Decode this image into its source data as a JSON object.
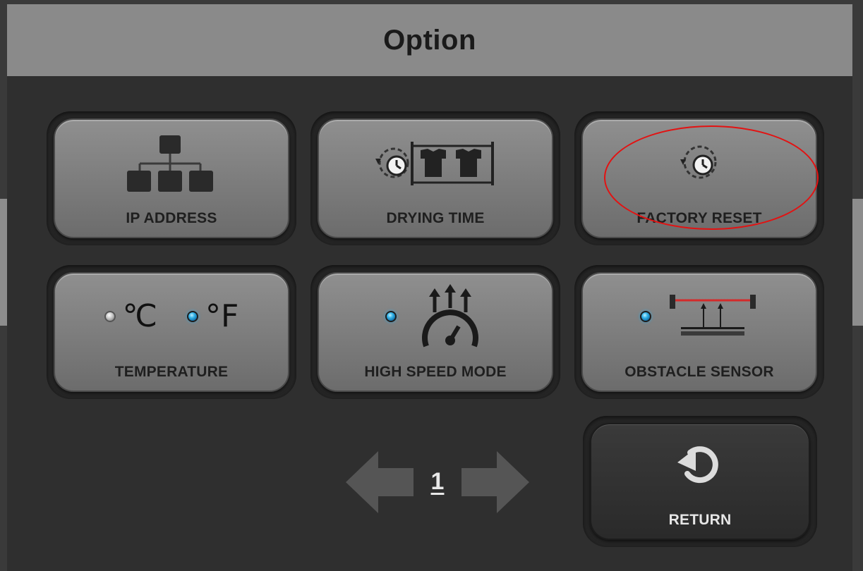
{
  "dialog": {
    "title": "Option"
  },
  "buttons": {
    "ip_address": {
      "label": "IP ADDRESS",
      "icon": "network-icon"
    },
    "drying_time": {
      "label": "DRYING TIME",
      "icon": "drying-timer-icon"
    },
    "factory_reset": {
      "label": "FACTORY RESET",
      "icon": "reset-clock-icon"
    },
    "temperature": {
      "label": "TEMPERATURE",
      "celsius_symbol": "℃",
      "fahrenheit_symbol": "°F",
      "selected_unit": "°F"
    },
    "high_speed_mode": {
      "label": "HIGH SPEED MODE",
      "icon": "speedometer-icon",
      "enabled": true
    },
    "obstacle_sensor": {
      "label": "OBSTACLE SENSOR",
      "icon": "sensor-beam-icon",
      "enabled": true
    }
  },
  "pagination": {
    "current_page": "1"
  },
  "return_button": {
    "label": "RETURN",
    "icon": "return-arrow-icon"
  },
  "colors": {
    "title_bar": "#8a8a8a",
    "dialog_bg": "#2f2f2f",
    "led_on": "#34b4e8",
    "highlight": "#e31212"
  }
}
